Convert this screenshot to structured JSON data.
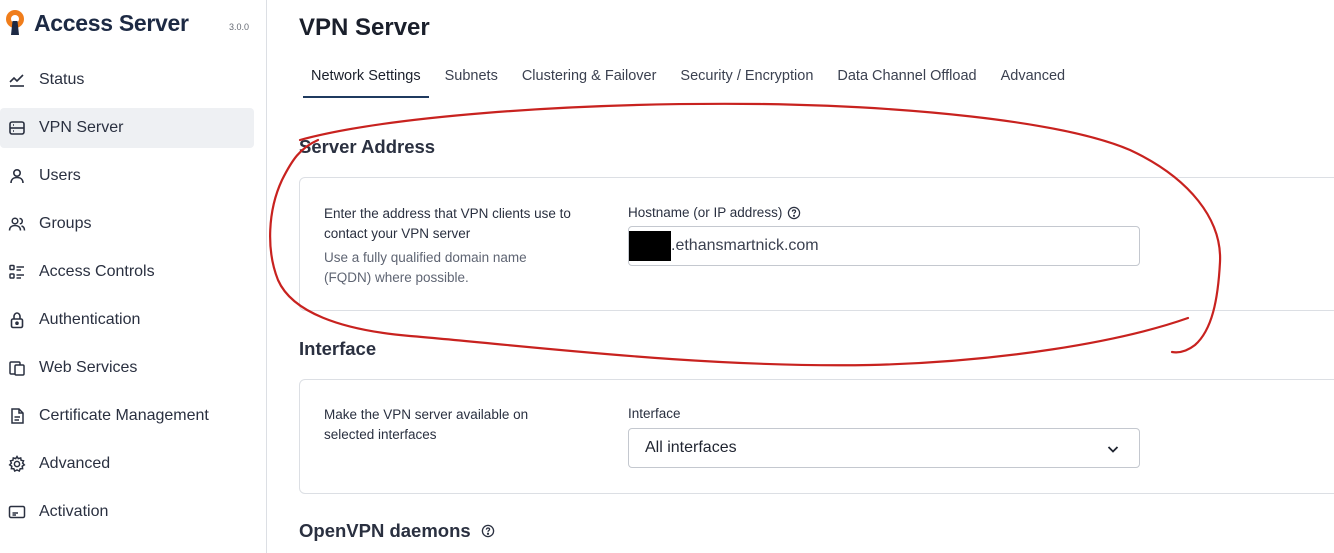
{
  "app": {
    "name": "Access Server",
    "version": "3.0.0"
  },
  "sidebar": {
    "items": [
      {
        "label": "Status",
        "icon": "chart-line-icon",
        "active": false
      },
      {
        "label": "VPN Server",
        "icon": "server-icon",
        "active": true
      },
      {
        "label": "Users",
        "icon": "user-icon",
        "active": false
      },
      {
        "label": "Groups",
        "icon": "users-icon",
        "active": false
      },
      {
        "label": "Access Controls",
        "icon": "list-check-icon",
        "active": false
      },
      {
        "label": "Authentication",
        "icon": "lock-icon",
        "active": false
      },
      {
        "label": "Web Services",
        "icon": "copy-window-icon",
        "active": false
      },
      {
        "label": "Certificate Management",
        "icon": "document-icon",
        "active": false
      },
      {
        "label": "Advanced",
        "icon": "gear-icon",
        "active": false
      },
      {
        "label": "Activation",
        "icon": "card-icon",
        "active": false
      }
    ]
  },
  "page": {
    "title": "VPN Server",
    "tabs": [
      {
        "label": "Network Settings",
        "active": true
      },
      {
        "label": "Subnets",
        "active": false
      },
      {
        "label": "Clustering & Failover",
        "active": false
      },
      {
        "label": "Security / Encryption",
        "active": false
      },
      {
        "label": "Data Channel Offload",
        "active": false
      },
      {
        "label": "Advanced",
        "active": false
      }
    ]
  },
  "server_address": {
    "title": "Server Address",
    "desc": "Enter the address that VPN clients use to contact your VPN server",
    "hint": "Use a fully qualified domain name (FQDN) where possible.",
    "field_label": "Hostname (or IP address)",
    "value": ".ethansmartnick.com"
  },
  "interface": {
    "title": "Interface",
    "desc": "Make the VPN server available on selected interfaces",
    "field_label": "Interface",
    "selected": "All interfaces"
  },
  "openvpn": {
    "title": "OpenVPN daemons"
  },
  "colors": {
    "brand_navy": "#1d2a44",
    "logo_orange": "#f07d1b",
    "active_tab_underline": "#1f3a5f",
    "annotation_red": "#c8221f"
  }
}
